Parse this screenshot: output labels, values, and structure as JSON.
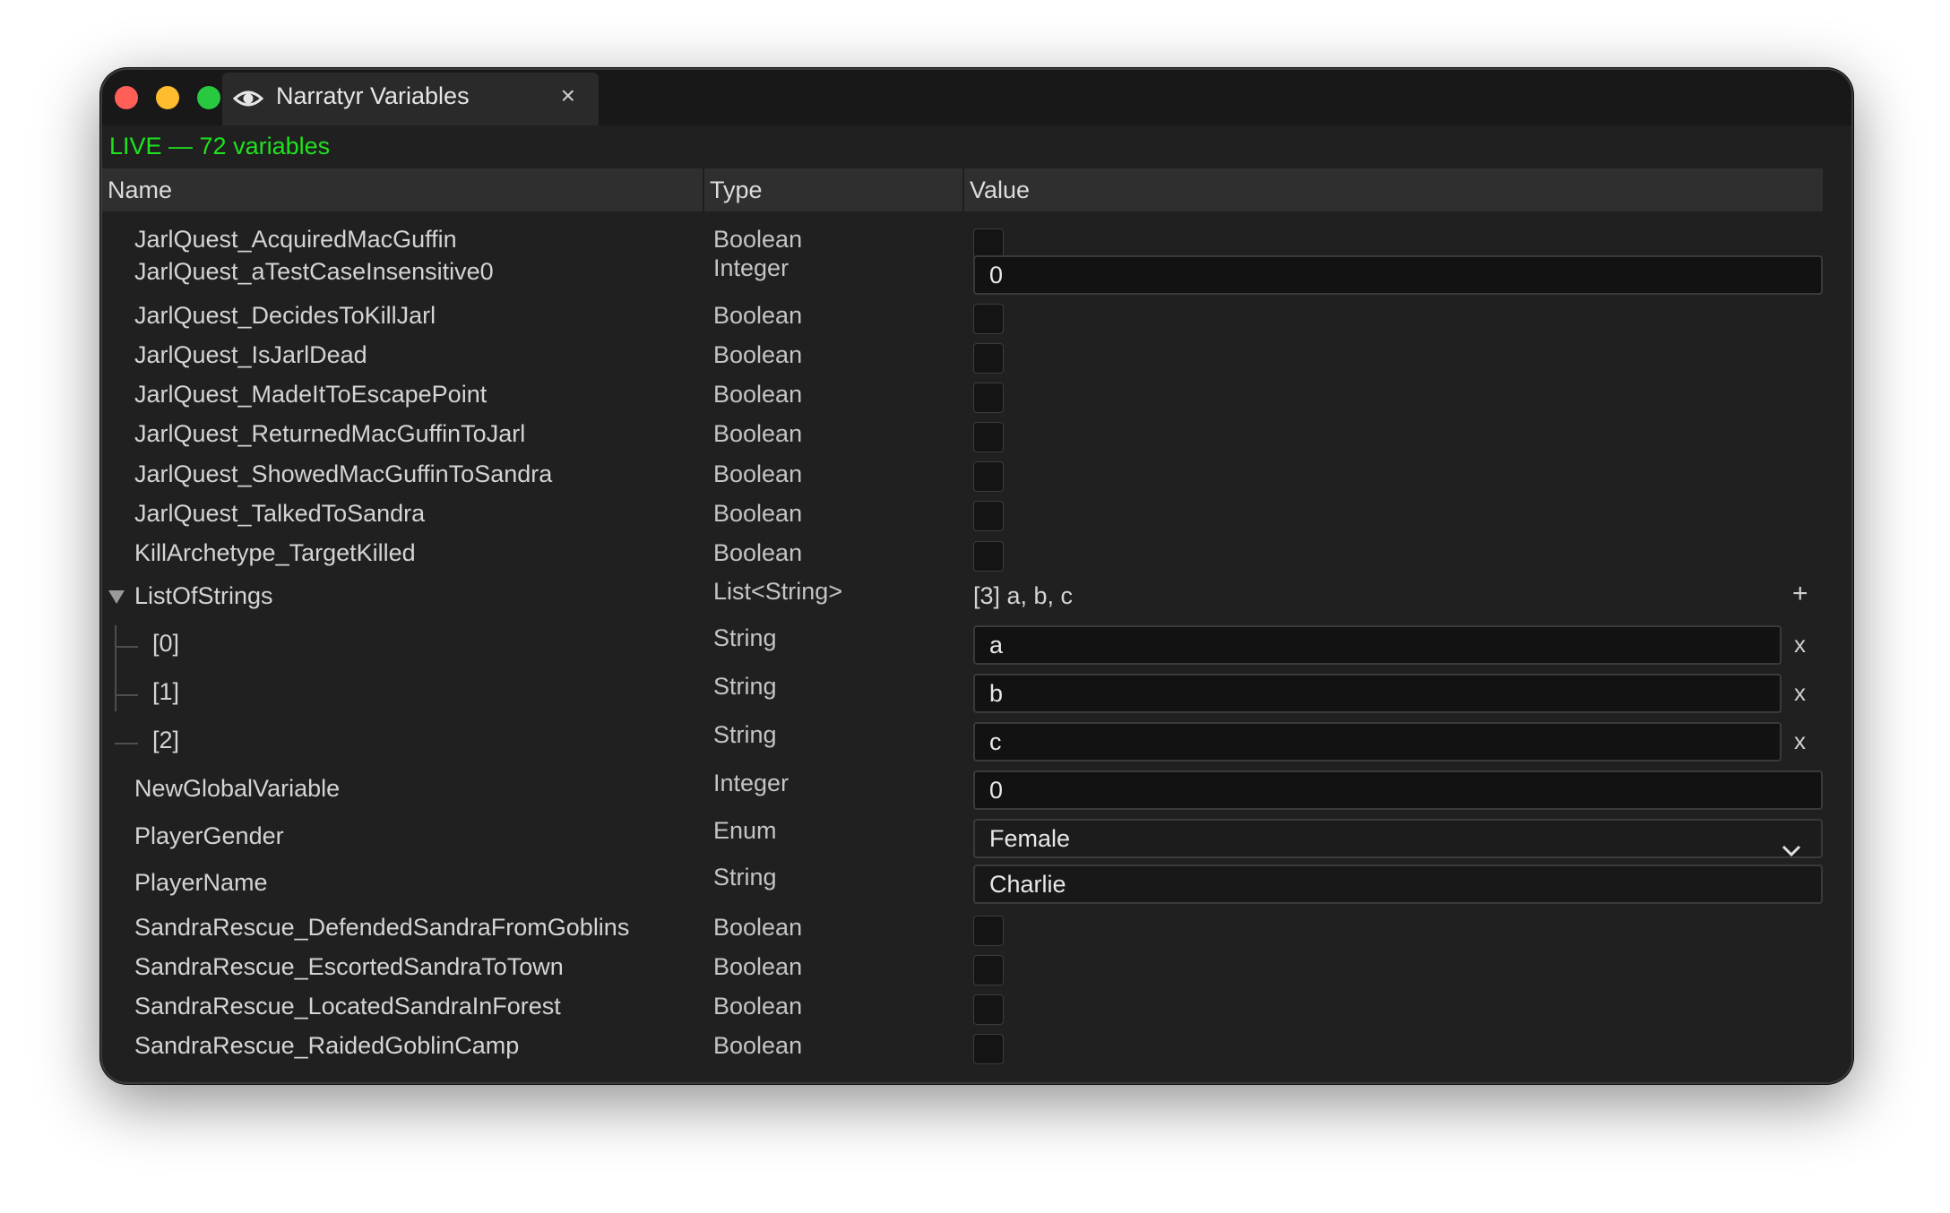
{
  "window": {
    "tab_title": "Narratyr Variables",
    "tab_close": "×",
    "status": "LIVE — 72 variables"
  },
  "table": {
    "columns": [
      "Name",
      "Type",
      "Value"
    ],
    "rows": [
      {
        "name": "JarlQuest_AcquiredMacGuffin",
        "type": "Boolean"
      },
      {
        "name": "JarlQuest_aTestCaseInsensitive0",
        "type": "Integer",
        "value": "0"
      },
      {
        "name": "JarlQuest_DecidesToKillJarl",
        "type": "Boolean"
      },
      {
        "name": "JarlQuest_IsJarlDead",
        "type": "Boolean"
      },
      {
        "name": "JarlQuest_MadeItToEscapePoint",
        "type": "Boolean"
      },
      {
        "name": "JarlQuest_ReturnedMacGuffinToJarl",
        "type": "Boolean"
      },
      {
        "name": "JarlQuest_ShowedMacGuffinToSandra",
        "type": "Boolean"
      },
      {
        "name": "JarlQuest_TalkedToSandra",
        "type": "Boolean"
      },
      {
        "name": "KillArchetype_TargetKilled",
        "type": "Boolean"
      },
      {
        "name": "ListOfStrings",
        "type": "List<String>",
        "value": "[3] a, b, c",
        "action": "+"
      },
      {
        "name": "[0]",
        "type": "String",
        "value": "a",
        "action": "x"
      },
      {
        "name": "[1]",
        "type": "String",
        "value": "b",
        "action": "x"
      },
      {
        "name": "[2]",
        "type": "String",
        "value": "c",
        "action": "x"
      },
      {
        "name": "NewGlobalVariable",
        "type": "Integer",
        "value": "0"
      },
      {
        "name": "PlayerGender",
        "type": "Enum",
        "value": "Female"
      },
      {
        "name": "PlayerName",
        "type": "String",
        "value": "Charlie"
      },
      {
        "name": "SandraRescue_DefendedSandraFromGoblins",
        "type": "Boolean"
      },
      {
        "name": "SandraRescue_EscortedSandraToTown",
        "type": "Boolean"
      },
      {
        "name": "SandraRescue_LocatedSandraInForest",
        "type": "Boolean"
      },
      {
        "name": "SandraRescue_RaidedGoblinCamp",
        "type": "Boolean"
      }
    ]
  },
  "colors": {
    "live_status": "#1ee31e",
    "traffic_red": "#ff5f57",
    "traffic_yellow": "#febc2e",
    "traffic_green": "#28c840"
  },
  "icons": [
    "eye-icon",
    "close-icon",
    "expand-triangle-icon",
    "chevron-down-icon"
  ]
}
